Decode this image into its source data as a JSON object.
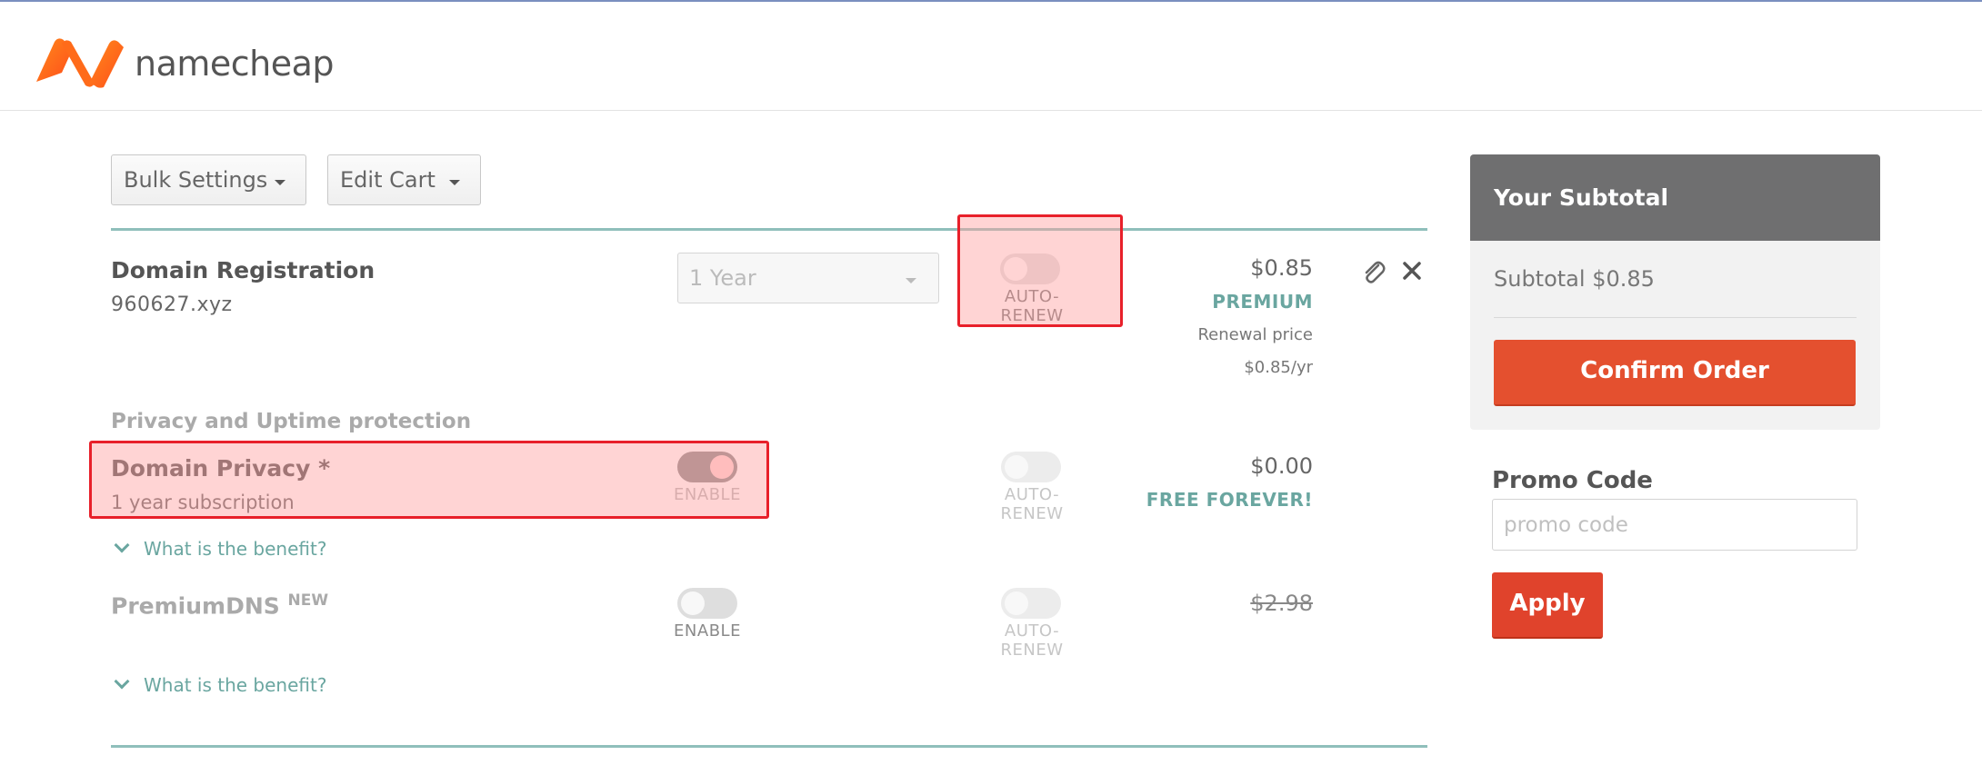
{
  "brand": {
    "name": "namecheap",
    "colors": {
      "orange": "#ff6b1a",
      "red": "#e4502f",
      "teal": "#6aa6a0",
      "highlight": "#e8202a"
    }
  },
  "toolbar": {
    "bulk_settings": "Bulk Settings",
    "edit_cart": "Edit Cart"
  },
  "cart": {
    "item": {
      "title": "Domain Registration",
      "domain": "960627.xyz",
      "duration": "1 Year",
      "auto_renew_label": "AUTO-RENEW",
      "auto_renew_on": false,
      "price": "$0.85",
      "price_tag": "PREMIUM",
      "renewal_label": "Renewal price",
      "renewal_price": "$0.85/yr",
      "icons": [
        "paperclip-icon",
        "close-icon"
      ]
    },
    "section_title": "Privacy and Uptime protection",
    "addons": [
      {
        "title": "Domain Privacy *",
        "subtitle": "1 year subscription",
        "enable_label": "ENABLE",
        "enabled": true,
        "auto_renew_label": "AUTO-RENEW",
        "price": "$0.00",
        "price_tag": "FREE FOREVER!",
        "benefit_link": "What is the benefit?"
      },
      {
        "title": "PremiumDNS",
        "badge": "NEW",
        "enable_label": "ENABLE",
        "enabled": false,
        "auto_renew_label": "AUTO-RENEW",
        "price": "$2.98",
        "benefit_link": "What is the benefit?"
      }
    ]
  },
  "sidebar": {
    "title": "Your Subtotal",
    "subtotal": "Subtotal $0.85",
    "confirm_label": "Confirm Order",
    "promo_label": "Promo Code",
    "promo_placeholder": "promo code",
    "promo_value": "",
    "apply_label": "Apply"
  }
}
